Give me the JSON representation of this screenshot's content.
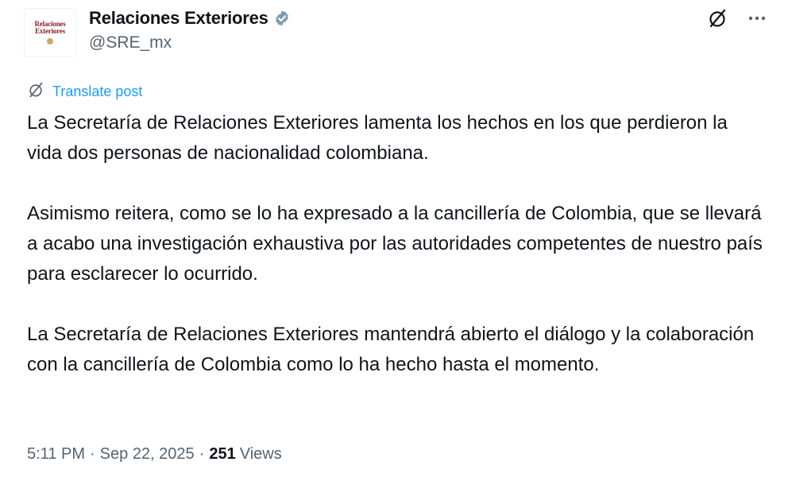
{
  "account": {
    "display_name": "Relaciones Exteriores",
    "handle": "@SRE_mx",
    "avatar_text_line1": "Relaciones",
    "avatar_text_line2": "Exteriores",
    "verified_icon": "verified-badge-icon",
    "verified_color": "#829aab"
  },
  "actions": {
    "grok_icon": "slashed-circle-icon",
    "more_icon": "more-horizontal-icon"
  },
  "translate": {
    "icon": "translate-icon",
    "label": "Translate post",
    "color": "#1d9bf0"
  },
  "post": {
    "paragraphs": [
      "La Secretaría de Relaciones Exteriores lamenta los hechos en los que perdieron la vida dos personas de nacionalidad colombiana.",
      "Asimismo reitera, como se lo ha expresado a la cancillería de Colombia, que se llevará a acabo una investigación exhaustiva por las autoridades competentes de nuestro país para esclarecer lo ocurrido.",
      "La Secretaría de Relaciones Exteriores mantendrá abierto el diálogo y la colaboración con la cancillería de Colombia como lo ha hecho hasta el momento."
    ]
  },
  "meta": {
    "time": "5:11 PM",
    "separator": "·",
    "date": "Sep 22, 2025",
    "views_count": "251",
    "views_label": "Views"
  }
}
